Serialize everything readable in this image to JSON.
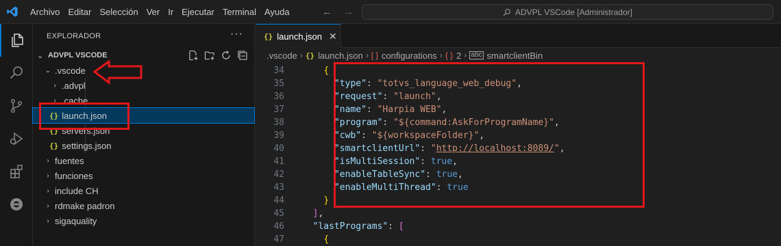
{
  "titlebar": {
    "menu": [
      "Archivo",
      "Editar",
      "Selección",
      "Ver",
      "Ir",
      "Ejecutar",
      "Terminal",
      "Ayuda"
    ],
    "search_text": "ADVPL VSCode [Administrador]",
    "icons": [
      "vscode-logo-icon",
      "arrow-left-icon",
      "arrow-right-icon",
      "search-icon"
    ]
  },
  "activitybar": {
    "items": [
      "explorer-icon",
      "search-icon",
      "source-control-icon",
      "run-debug-icon",
      "extensions-icon",
      "totvs-icon"
    ]
  },
  "sidebar": {
    "title": "EXPLORADOR",
    "more": "···",
    "workspace": "ADVPL VSCODE",
    "tree": [
      {
        "label": ".vscode",
        "twist": "⌄",
        "level": 1
      },
      {
        "label": ".advpl",
        "twist": "›",
        "level": 2
      },
      {
        "label": ".cache",
        "twist": "›",
        "level": 2
      },
      {
        "label": "launch.json",
        "icon": "{}",
        "level": 2,
        "selected": true
      },
      {
        "label": "servers.json",
        "icon": "{}",
        "level": 2
      },
      {
        "label": "settings.json",
        "icon": "{}",
        "level": 2
      },
      {
        "label": "fuentes",
        "twist": "›",
        "level": 1
      },
      {
        "label": "funciones",
        "twist": "›",
        "level": 1
      },
      {
        "label": "include CH",
        "twist": "›",
        "level": 1
      },
      {
        "label": "rdmake padron",
        "twist": "›",
        "level": 1
      },
      {
        "label": "sigaquality",
        "twist": "›",
        "level": 1
      }
    ]
  },
  "editor": {
    "tab_label": "launch.json",
    "tab_icon": "{}",
    "breadcrumbs": {
      "folder": ".vscode",
      "file": "launch.json",
      "array": "configurations",
      "index": "2",
      "prop": "smartclientBin"
    },
    "lines": [
      {
        "n": "34",
        "html": "<span class='br1'>{</span>",
        "indent": 2
      },
      {
        "n": "35",
        "key": "\"type\"",
        "val": "\"totvs_language_web_debug\"",
        "tail": ","
      },
      {
        "n": "36",
        "key": "\"request\"",
        "val": "\"launch\"",
        "tail": ","
      },
      {
        "n": "37",
        "key": "\"name\"",
        "val": "\"Harpia WEB\"",
        "tail": ","
      },
      {
        "n": "38",
        "key": "\"program\"",
        "val": "\"${command:AskForProgramName}\"",
        "tail": ","
      },
      {
        "n": "39",
        "key": "\"cwb\"",
        "val": "\"${workspaceFolder}\"",
        "tail": ","
      },
      {
        "n": "40",
        "key": "\"smartclientUrl\"",
        "val": "\"",
        "url": "http://localhost:8089/",
        "val2": "\"",
        "tail": ","
      },
      {
        "n": "41",
        "key": "\"isMultiSession\"",
        "bool": "true",
        "tail": ","
      },
      {
        "n": "42",
        "key": "\"enableTableSync\"",
        "bool": "true",
        "tail": ","
      },
      {
        "n": "43",
        "key": "\"enableMultiThread\"",
        "bool": "true",
        "tail": ""
      },
      {
        "n": "44",
        "close": "}"
      },
      {
        "n": "45",
        "close2": "],"
      },
      {
        "n": "46",
        "key": "\"lastPrograms\"",
        "arr": "["
      },
      {
        "n": "47",
        "open": "{"
      }
    ]
  },
  "colors": {
    "accent": "#0078d4",
    "annotation": "#e2171b",
    "json_icon": "#cbcb41"
  }
}
